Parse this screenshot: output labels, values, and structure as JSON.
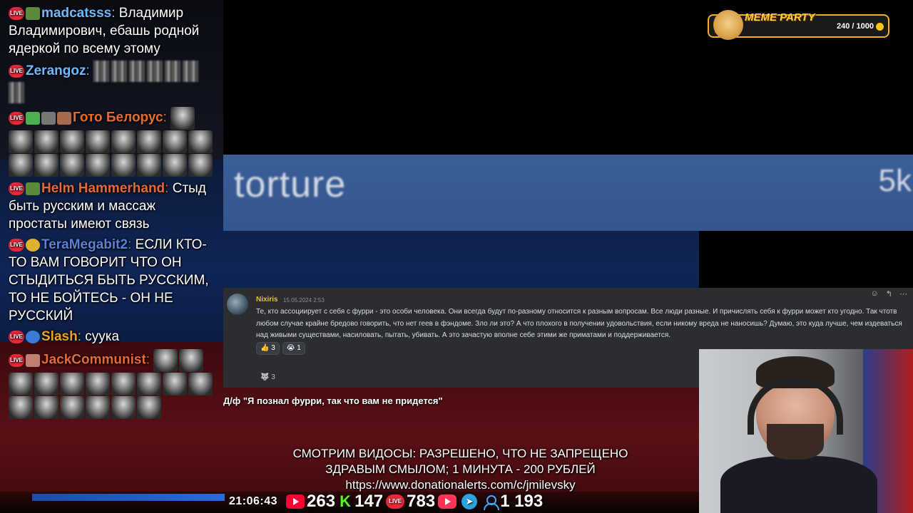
{
  "chat": {
    "messages": [
      {
        "user": "madcatsss",
        "user_color": "#6fb7ff",
        "text": "Владимир Владимирович, ебашь родной ядеркой по всему этому"
      },
      {
        "user": "Zerangoz",
        "user_color": "#6fb7ff",
        "text": ""
      },
      {
        "user": "Гото Белорус",
        "user_color": "#e56b2f",
        "text": ""
      },
      {
        "user": "Helm Hammerhand",
        "user_color": "#e5683a",
        "text": "Стыд быть русским и массаж простаты имеют связь"
      },
      {
        "user": "TeraMegabit2",
        "user_color": "#5c7fd8",
        "text": "ЕСЛИ КТО-ТО ВАМ ГОВОРИТ ЧТО ОН СТЫДИТЬСЯ БЫТЬ РУССКИМ, ТО НЕ БОЙТЕСЬ - ОН НЕ РУССКИЙ"
      },
      {
        "user": "Slash",
        "user_color": "#f0a020",
        "text": "суука"
      },
      {
        "user": "JackCommunist",
        "user_color": "#e5683a",
        "text": ""
      }
    ]
  },
  "meme_party": {
    "title": "MEME PARTY",
    "progress": "240 / 1000",
    "fraction": 0.24
  },
  "banner": {
    "word": "torture",
    "value": "5k"
  },
  "discord": {
    "author": "Nixiris",
    "timestamp": "15.05.2024 2:53",
    "text": "Те, кто ассоциирует с себя с фурри - это особи человека. Они всегда будут по-разному относится к разным вопросам. Все люди разные. И причислять себя к фурри может кто угодно. Так чтотв любом случае крайне бредово говорить, что нет геев в фэндоме. Зло ли это? А что плохого в получении удовольствия, если никому вреда не наносишь? Думаю, это куда лучше, чем издеваться над живыми существами, насиловать, пытать, убивать. А это зачастую вполне себе этими же приматами и поддерживается.",
    "reactions": [
      {
        "emoji": "👍",
        "count": "3"
      },
      {
        "emoji": "😭",
        "count": "1"
      }
    ],
    "thread_count": "3"
  },
  "caption": "Д/ф \"Я познал фурри, так что вам не придется\"",
  "donation": {
    "line1": "СМОТРИМ ВИДОСЫ: РАЗРЕШЕНО, ЧТО НЕ ЗАПРЕЩЕНО",
    "line2": "ЗДРАВЫМ СМЫЛОМ; 1 МИНУТА - 200 РУБЛЕЙ",
    "line3": "https://www.donationalerts.com/c/jmilevsky"
  },
  "stats": {
    "clock": "21:06:43",
    "youtube": "263",
    "kick": "147",
    "live": "783",
    "viewers": "1 193"
  },
  "colors": {
    "banner_bg": "#3a5e98",
    "discord_bg": "#2b2d31",
    "discord_author": "#e5c047",
    "meme_border": "#f0b020"
  }
}
